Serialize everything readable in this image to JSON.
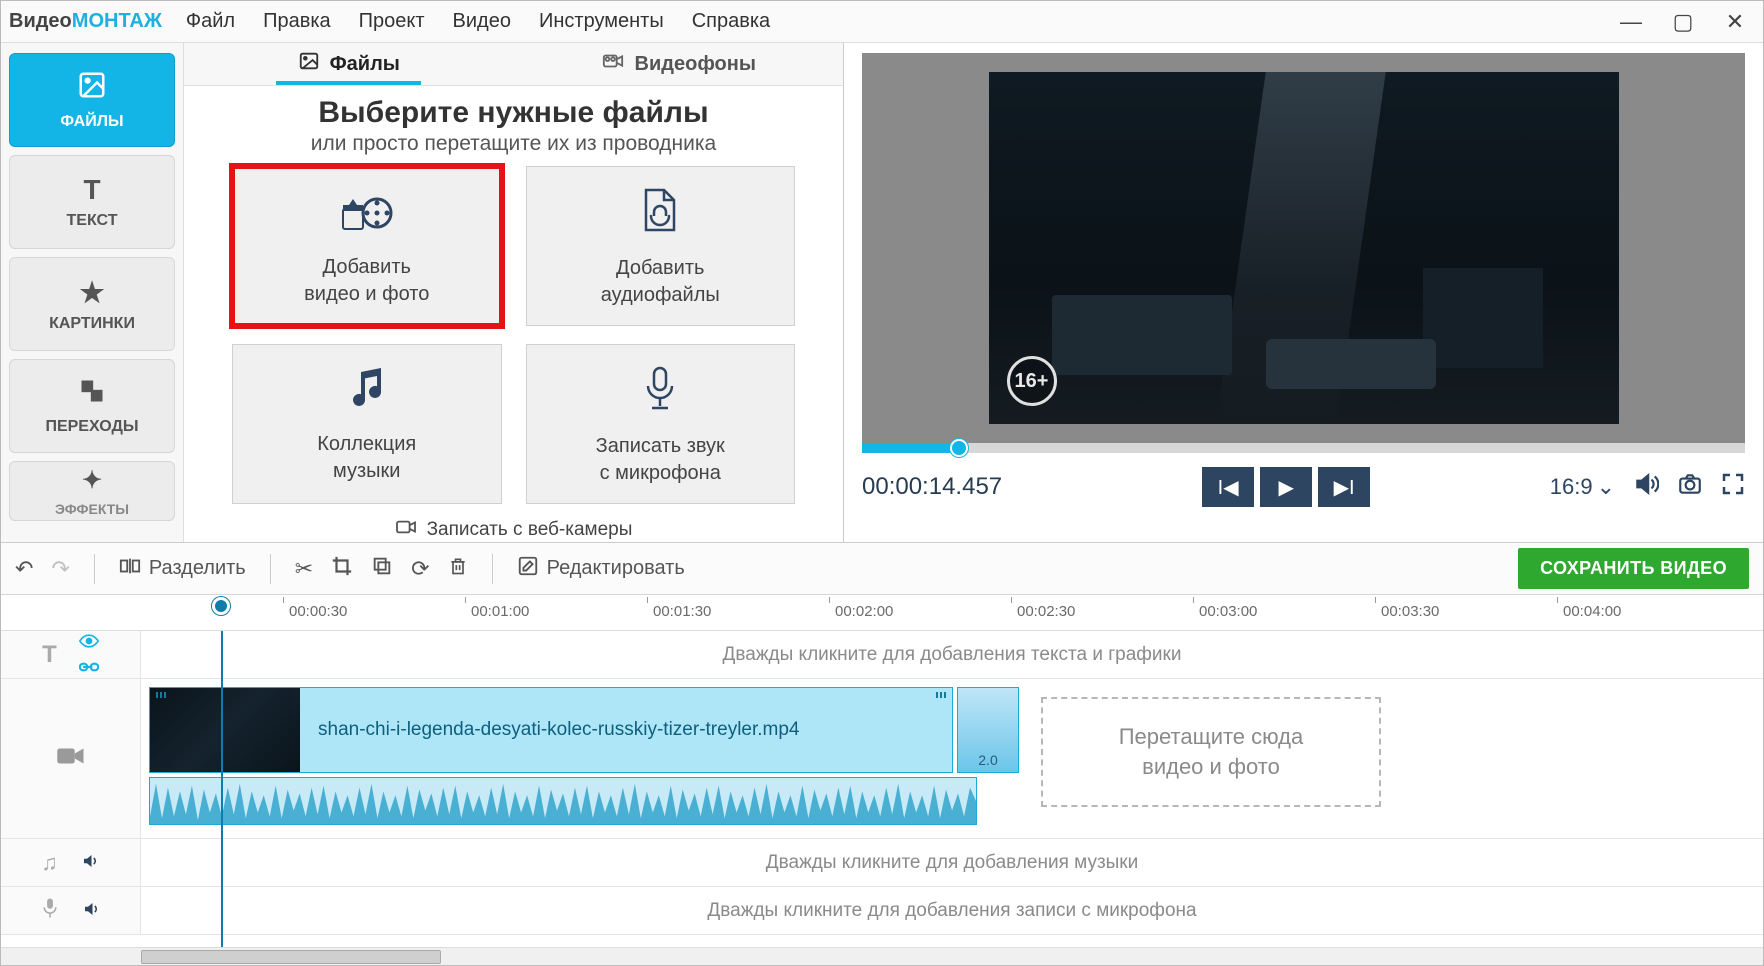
{
  "app": {
    "logo_a": "Видео",
    "logo_b": "МОНТАЖ"
  },
  "menu": [
    "Файл",
    "Правка",
    "Проект",
    "Видео",
    "Инструменты",
    "Справка"
  ],
  "sidebar": [
    {
      "label": "ФАЙЛЫ"
    },
    {
      "label": "ТЕКСТ"
    },
    {
      "label": "КАРТИНКИ"
    },
    {
      "label": "ПЕРЕХОДЫ"
    },
    {
      "label": "ЭФФЕКТЫ"
    }
  ],
  "tabs": {
    "files": "Файлы",
    "backgrounds": "Видеофоны"
  },
  "choose": {
    "title": "Выберите нужные файлы",
    "subtitle": "или просто перетащите их из проводника"
  },
  "add": {
    "video_l1": "Добавить",
    "video_l2": "видео и фото",
    "audio_l1": "Добавить",
    "audio_l2": "аудиофайлы",
    "music_l1": "Коллекция",
    "music_l2": "музыки",
    "mic_l1": "Записать звук",
    "mic_l2": "с микрофона",
    "webcam": "Записать с веб-камеры"
  },
  "preview": {
    "age": "16+",
    "timecode": "00:00:14.457",
    "aspect": "16:9"
  },
  "toolbar": {
    "split": "Разделить",
    "edit": "Редактировать",
    "save": "СОХРАНИТЬ ВИДЕО"
  },
  "ruler": {
    "t0": "00:00:30",
    "t1": "00:01:00",
    "t2": "00:01:30",
    "t3": "00:02:00",
    "t4": "00:02:30",
    "t5": "00:03:00",
    "t6": "00:03:30",
    "t7": "00:04:00"
  },
  "track_hints": {
    "text": "Дважды кликните для добавления текста и графики",
    "music": "Дважды кликните для добавления музыки",
    "mic": "Дважды кликните для добавления записи с микрофона"
  },
  "clip": {
    "filename": "shan-chi-i-legenda-desyati-kolec-russkiy-tizer-treyler.mp4",
    "speed": "2.0"
  },
  "dropzone": {
    "l1": "Перетащите сюда",
    "l2": "видео и фото"
  }
}
